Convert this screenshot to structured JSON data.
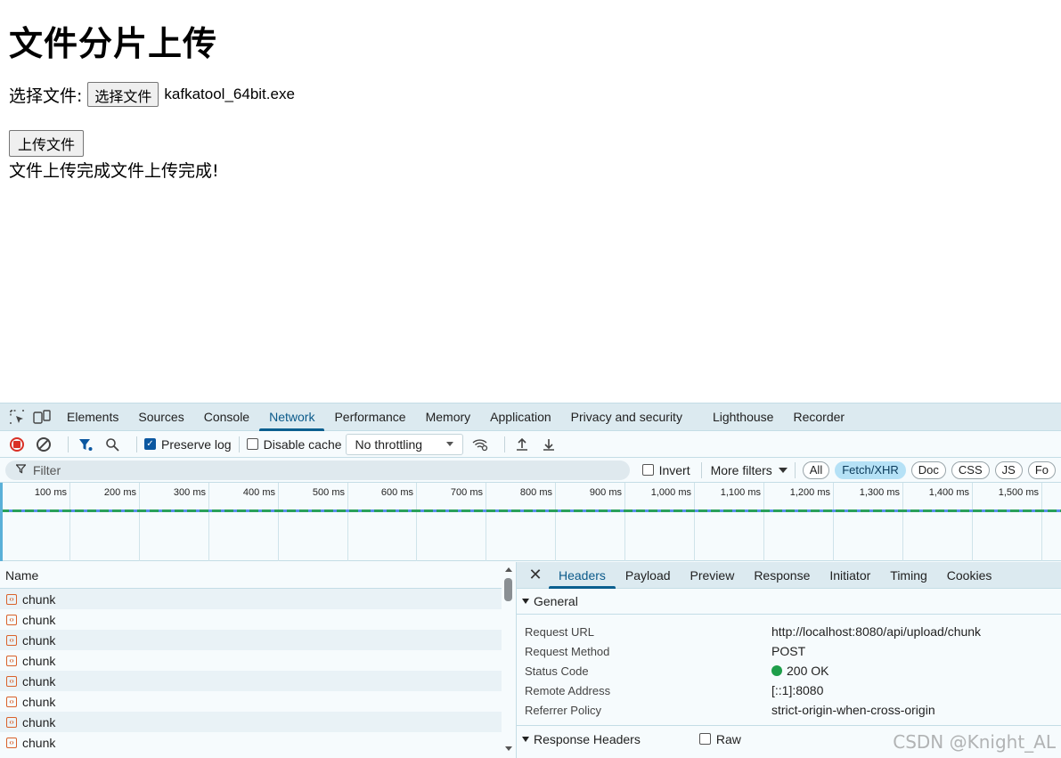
{
  "page": {
    "title": "文件分片上传",
    "file_label": "选择文件:",
    "file_button": "选择文件",
    "file_name": "kafkatool_64bit.exe",
    "upload_button": "上传文件",
    "status": "文件上传完成文件上传完成!"
  },
  "devtools": {
    "tabs": [
      "Elements",
      "Sources",
      "Console",
      "Network",
      "Performance",
      "Memory",
      "Application",
      "Privacy and security",
      "Lighthouse",
      "Recorder"
    ],
    "active_tab": "Network",
    "toolbar": {
      "preserve_log": "Preserve log",
      "preserve_log_checked": true,
      "disable_cache": "Disable cache",
      "disable_cache_checked": false,
      "throttling": "No throttling"
    },
    "filter": {
      "placeholder": "Filter",
      "invert": "Invert",
      "more_filters": "More filters",
      "chips": [
        "All",
        "Fetch/XHR",
        "Doc",
        "CSS",
        "JS",
        "Fo"
      ],
      "active_chip": "Fetch/XHR"
    },
    "timeline": {
      "ticks": [
        "100 ms",
        "200 ms",
        "300 ms",
        "400 ms",
        "500 ms",
        "600 ms",
        "700 ms",
        "800 ms",
        "900 ms",
        "1,000 ms",
        "1,100 ms",
        "1,200 ms",
        "1,300 ms",
        "1,400 ms",
        "1,500 ms"
      ]
    },
    "requests": {
      "column_name": "Name",
      "rows": [
        "chunk",
        "chunk",
        "chunk",
        "chunk",
        "chunk",
        "chunk",
        "chunk",
        "chunk"
      ]
    },
    "details": {
      "tabs": [
        "Headers",
        "Payload",
        "Preview",
        "Response",
        "Initiator",
        "Timing",
        "Cookies"
      ],
      "active_tab": "Headers",
      "general_title": "General",
      "general": [
        {
          "key": "Request URL",
          "value": "http://localhost:8080/api/upload/chunk"
        },
        {
          "key": "Request Method",
          "value": "POST"
        },
        {
          "key": "Status Code",
          "value": "200 OK"
        },
        {
          "key": "Remote Address",
          "value": "[::1]:8080"
        },
        {
          "key": "Referrer Policy",
          "value": "strict-origin-when-cross-origin"
        }
      ],
      "response_headers_title": "Response Headers",
      "raw_label": "Raw"
    }
  },
  "watermark": "CSDN @Knight_AL",
  "colors": {
    "accent": "#0b5f8f",
    "status_ok": "#1e9e4a",
    "record": "#d93025",
    "xhr_icon": "#d9622b"
  }
}
